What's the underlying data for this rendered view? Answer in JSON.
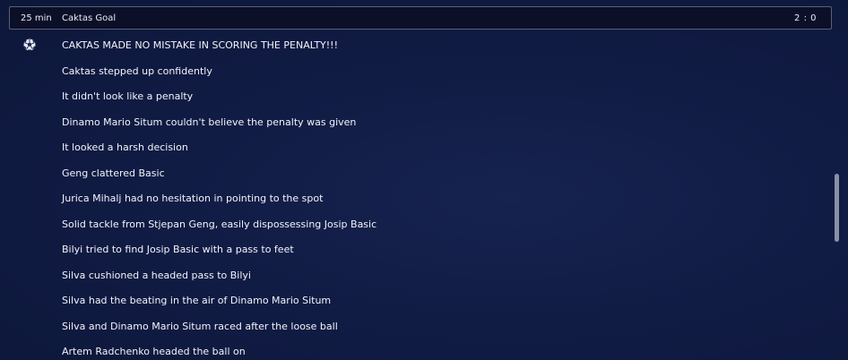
{
  "event": {
    "minute": "25 min",
    "title": "Caktas Goal",
    "score": "2 : 0"
  },
  "icons": {
    "event_icon": "football-ball-icon"
  },
  "commentary": [
    "CAKTAS MADE NO MISTAKE IN SCORING THE PENALTY!!!",
    "Caktas stepped up confidently",
    "It didn't look like a penalty",
    "Dinamo Mario Situm couldn't believe the penalty was given",
    "It looked a harsh decision",
    "Geng clattered Basic",
    "Jurica Mihalj had no hesitation in pointing to the spot",
    "Solid tackle from Stjepan Geng, easily dispossessing Josip Basic",
    "Bilyi tried to find Josip Basic with a pass to feet",
    "Silva cushioned a headed pass to Bilyi",
    "Silva had the beating in the air of Dinamo Mario Situm",
    "Silva and Dinamo Mario Situm raced after the loose ball",
    "Artem Radchenko headed the ball on"
  ],
  "colors": {
    "background": "#111c45",
    "header_background": "#0b1028",
    "header_border": "#5a6078",
    "text": "#f2f4fa",
    "scrollbar_thumb": "#8a8fa3"
  }
}
